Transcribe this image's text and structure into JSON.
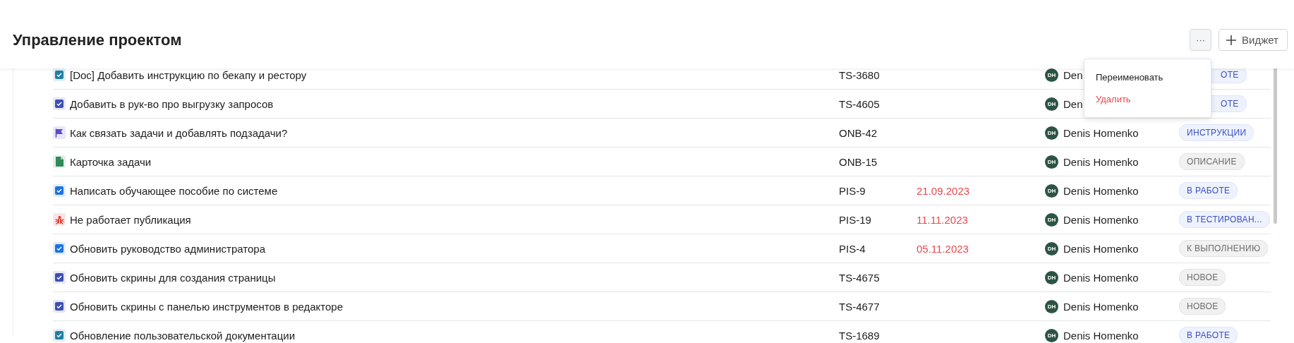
{
  "header": {
    "title": "Управление проектом",
    "more_button": "···",
    "add_button": "Виджет"
  },
  "menu": {
    "items": [
      {
        "label": "Переименовать",
        "kind": "normal"
      },
      {
        "label": "Удалить",
        "kind": "danger"
      }
    ]
  },
  "rows": [
    {
      "icon": {
        "kind": "checkbox",
        "color": "#1f7fa6"
      },
      "title": "[Doc] Добавить инструкцию по бекапу и рестору",
      "key": "TS-3680",
      "assignee_initials": "DH",
      "assignee": "Den",
      "status": {
        "label": "ОТЕ",
        "color": "#3b4fc2"
      }
    },
    {
      "icon": {
        "kind": "checkbox",
        "color": "#3e4fb5"
      },
      "title": "Добавить в рук-во про выгрузку запросов",
      "key": "TS-4605",
      "assignee_initials": "DH",
      "assignee": "Den",
      "status": {
        "label": "ОТЕ",
        "color": "#3b4fc2"
      }
    },
    {
      "icon": {
        "kind": "flag",
        "color": "#5b4bc4"
      },
      "title": "Как связать задачи и добавлять подзадачи?",
      "key": "ONB-42",
      "assignee_initials": "DH",
      "assignee": "Denis Homenko",
      "status": {
        "label": "ИНСТРУКЦИИ",
        "color": "#3b4fc2"
      }
    },
    {
      "icon": {
        "kind": "document",
        "color": "#2f8a57"
      },
      "title": "Карточка задачи",
      "key": "ONB-15",
      "assignee_initials": "DH",
      "assignee": "Denis Homenko",
      "status": {
        "label": "ОПИСАНИЕ",
        "color": "#6b6b6b"
      }
    },
    {
      "icon": {
        "kind": "checkbox",
        "color": "#1a73e8"
      },
      "title": "Написать обучающее пособие по системе",
      "key": "PIS-9",
      "due": "21.09.2023",
      "assignee_initials": "DH",
      "assignee": "Denis Homenko",
      "status": {
        "label": "В РАБОТЕ",
        "color": "#3b4fc2"
      }
    },
    {
      "icon": {
        "kind": "bug",
        "color": "#e0352b"
      },
      "title": "Не работает публикация",
      "key": "PIS-19",
      "due": "11.11.2023",
      "assignee_initials": "DH",
      "assignee": "Denis Homenko",
      "status": {
        "label": "В ТЕСТИРОВАН...",
        "color": "#3b4fc2"
      }
    },
    {
      "icon": {
        "kind": "checkbox",
        "color": "#1a73e8"
      },
      "title": "Обновить руководство администратора",
      "key": "PIS-4",
      "due": "05.11.2023",
      "assignee_initials": "DH",
      "assignee": "Denis Homenko",
      "status": {
        "label": "К ВЫПОЛНЕНИЮ",
        "color": "#6b6b6b"
      }
    },
    {
      "icon": {
        "kind": "checkbox",
        "color": "#3e4fb5"
      },
      "title": "Обновить скрины для создания страницы",
      "key": "TS-4675",
      "assignee_initials": "DH",
      "assignee": "Denis Homenko",
      "status": {
        "label": "НОВОЕ",
        "color": "#6b6b6b"
      }
    },
    {
      "icon": {
        "kind": "checkbox",
        "color": "#3e4fb5"
      },
      "title": "Обновить скрины с панелью инструментов в редакторе",
      "key": "TS-4677",
      "assignee_initials": "DH",
      "assignee": "Denis Homenko",
      "status": {
        "label": "НОВОЕ",
        "color": "#6b6b6b"
      }
    },
    {
      "icon": {
        "kind": "checkbox",
        "color": "#1f7fa6"
      },
      "title": "Обновление пользовательской документации",
      "key": "TS-1689",
      "assignee_initials": "DH",
      "assignee": "Denis Homenko",
      "status": {
        "label": "В РАБОТЕ",
        "color": "#3b4fc2"
      }
    }
  ]
}
